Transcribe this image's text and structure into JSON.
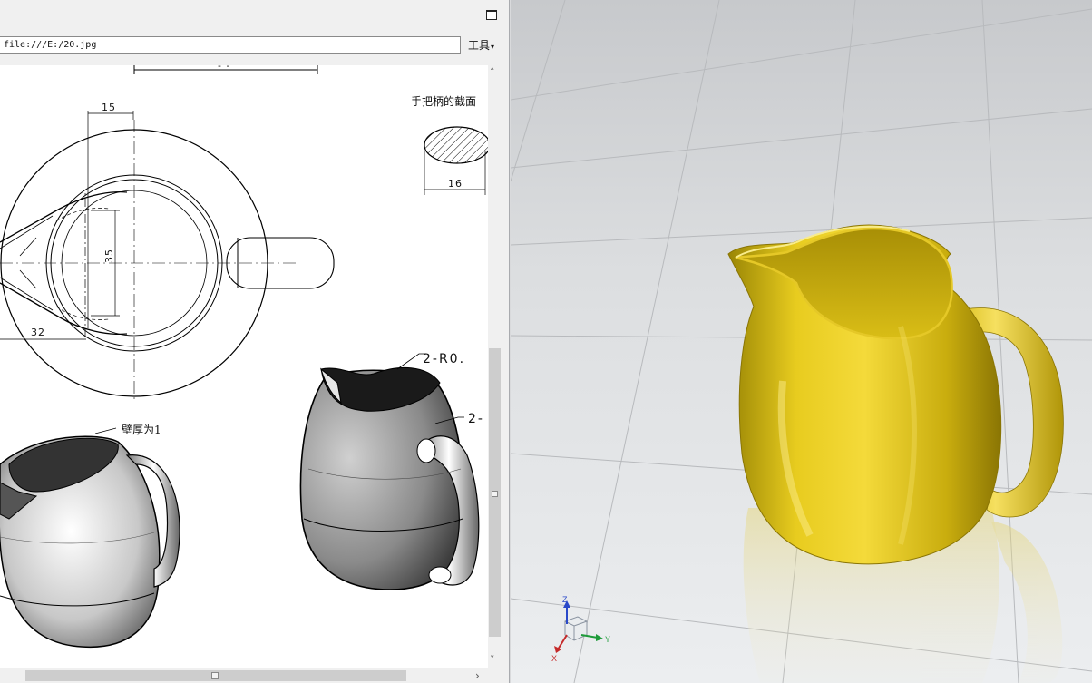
{
  "viewer": {
    "address": "file:///E:/20.jpg",
    "tools_label": "工具",
    "tools_arrow": "▾",
    "scroll_up": "˄",
    "scroll_down": "˅",
    "scroll_right": "›"
  },
  "drawing": {
    "top_dim": "- -",
    "dim_15": "15",
    "dim_35": "35",
    "dim_32": "32",
    "dim_16": "16",
    "handle_section_label": "手把柄的截面",
    "wall_thickness_note": "壁厚为1",
    "radius_label_1": "2-R0.",
    "radius_label_2": "2-"
  },
  "viewport": {
    "triad": {
      "z": "Z",
      "y": "Y",
      "x": "X"
    },
    "model_color": "#e3c61c",
    "background_top": "#c7c9cc",
    "background_bottom": "#eceef0"
  }
}
